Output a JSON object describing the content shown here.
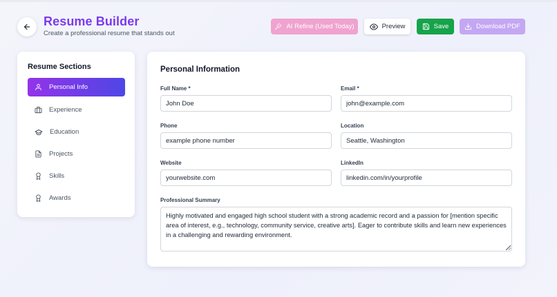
{
  "header": {
    "title": "Resume Builder",
    "subtitle": "Create a professional resume that stands out",
    "buttons": {
      "ai_refine": "AI Refine (Used Today)",
      "preview": "Preview",
      "save": "Save",
      "download": "Download PDF"
    }
  },
  "sidebar": {
    "title": "Resume Sections",
    "items": [
      {
        "label": "Personal Info",
        "icon": "user-icon",
        "active": true
      },
      {
        "label": "Experience",
        "icon": "briefcase-icon",
        "active": false
      },
      {
        "label": "Education",
        "icon": "graduation-cap-icon",
        "active": false
      },
      {
        "label": "Projects",
        "icon": "file-icon",
        "active": false
      },
      {
        "label": "Skills",
        "icon": "award-icon",
        "active": false
      },
      {
        "label": "Awards",
        "icon": "award-icon",
        "active": false
      }
    ]
  },
  "form": {
    "title": "Personal Information",
    "fields": {
      "full_name": {
        "label": "Full Name *",
        "value": "John Doe"
      },
      "email": {
        "label": "Email *",
        "value": "john@example.com"
      },
      "phone": {
        "label": "Phone",
        "value": "example phone number"
      },
      "location": {
        "label": "Location",
        "value": "Seattle, Washington"
      },
      "website": {
        "label": "Website",
        "value": "yourwebsite.com"
      },
      "linkedin": {
        "label": "LinkedIn",
        "value": "linkedin.com/in/yourprofile"
      },
      "summary": {
        "label": "Professional Summary",
        "value": "Highly motivated and engaged high school student with a strong academic record and a passion for [mention specific area of interest, e.g., technology, community service, creative arts]. Eager to contribute skills and learn new experiences in a challenging and rewarding environment."
      }
    }
  },
  "colors": {
    "brand": "#7c3aed",
    "save": "#16a34a",
    "refine": "#f0a3cf",
    "download": "#c4a7f3",
    "active_gradient_start": "#9333ea",
    "active_gradient_end": "#4f46e5"
  }
}
